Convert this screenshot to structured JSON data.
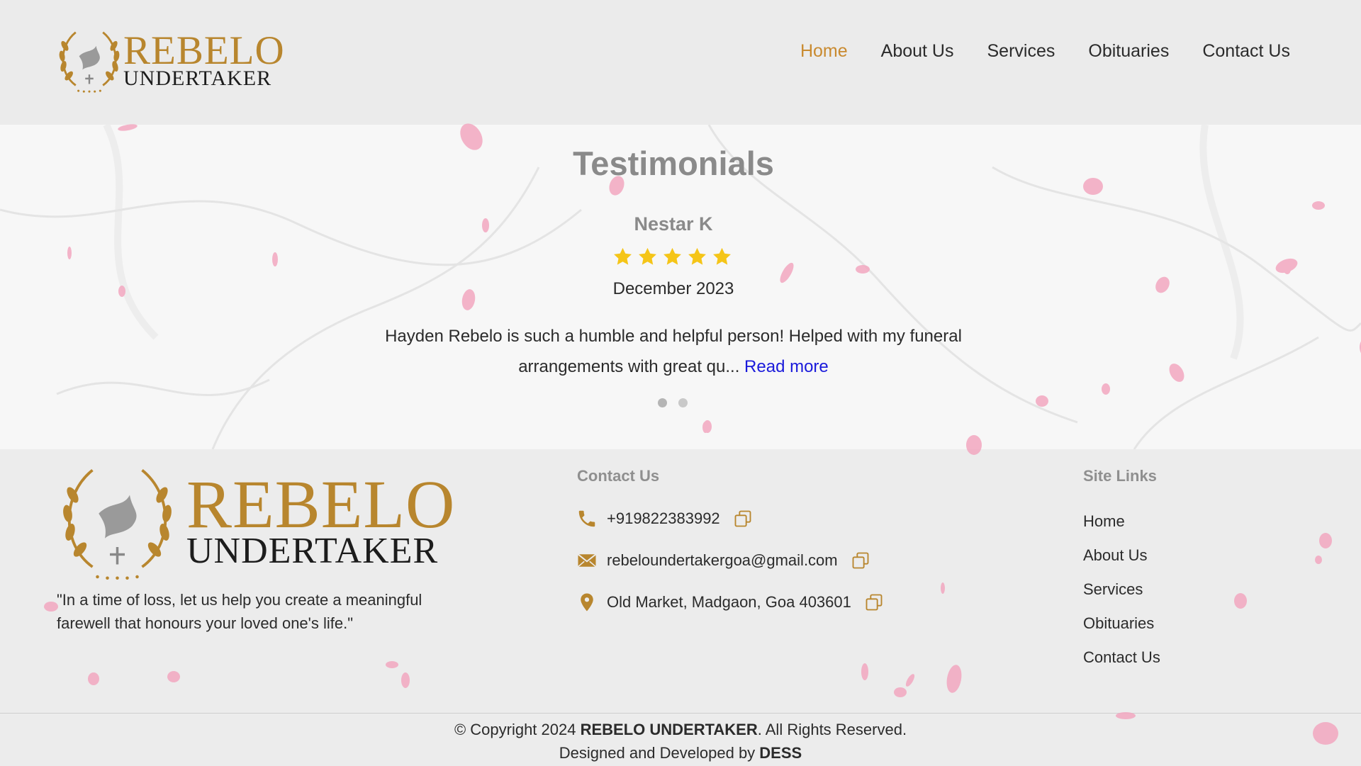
{
  "brand": {
    "name": "REBELO",
    "subtitle": "UNDERTAKER"
  },
  "nav": {
    "items": [
      {
        "label": "Home",
        "active": true
      },
      {
        "label": "About Us",
        "active": false
      },
      {
        "label": "Services",
        "active": false
      },
      {
        "label": "Obituaries",
        "active": false
      },
      {
        "label": "Contact Us",
        "active": false
      }
    ]
  },
  "testimonials": {
    "title": "Testimonials",
    "current": {
      "name": "Nestar K",
      "rating": 5,
      "date": "December 2023",
      "text": "Hayden Rebelo is such a humble and helpful person! Helped with my funeral arrangements with great qu...",
      "read_more": "Read more"
    },
    "slide_count": 2,
    "active_slide": 1
  },
  "footer": {
    "quote": "\"In a time of loss, let us help you create a meaningful farewell that honours your loved one's life.\"",
    "contact": {
      "title": "Contact Us",
      "phone": "+919822383992",
      "email": "rebeloundertakergoa@gmail.com",
      "address": "Old Market, Madgaon, Goa 403601"
    },
    "site_links": {
      "title": "Site Links",
      "items": [
        "Home",
        "About Us",
        "Services",
        "Obituaries",
        "Contact Us"
      ]
    },
    "copyright_prefix": "© Copyright 2024 ",
    "copyright_brand": "REBELO UNDERTAKER",
    "copyright_suffix": ". All Rights Reserved.",
    "designed_prefix": "Designed and Developed by ",
    "designed_by": "DESS"
  },
  "colors": {
    "accent": "#c98a2f",
    "gold": "#b8862e",
    "star": "#f5c518",
    "link": "#1a1adb",
    "petal": "#f2a7c0"
  },
  "icons": [
    "phone-icon",
    "mail-icon",
    "location-pin-icon",
    "copy-icon",
    "star-icon",
    "dove-icon",
    "laurel-wreath-icon"
  ]
}
